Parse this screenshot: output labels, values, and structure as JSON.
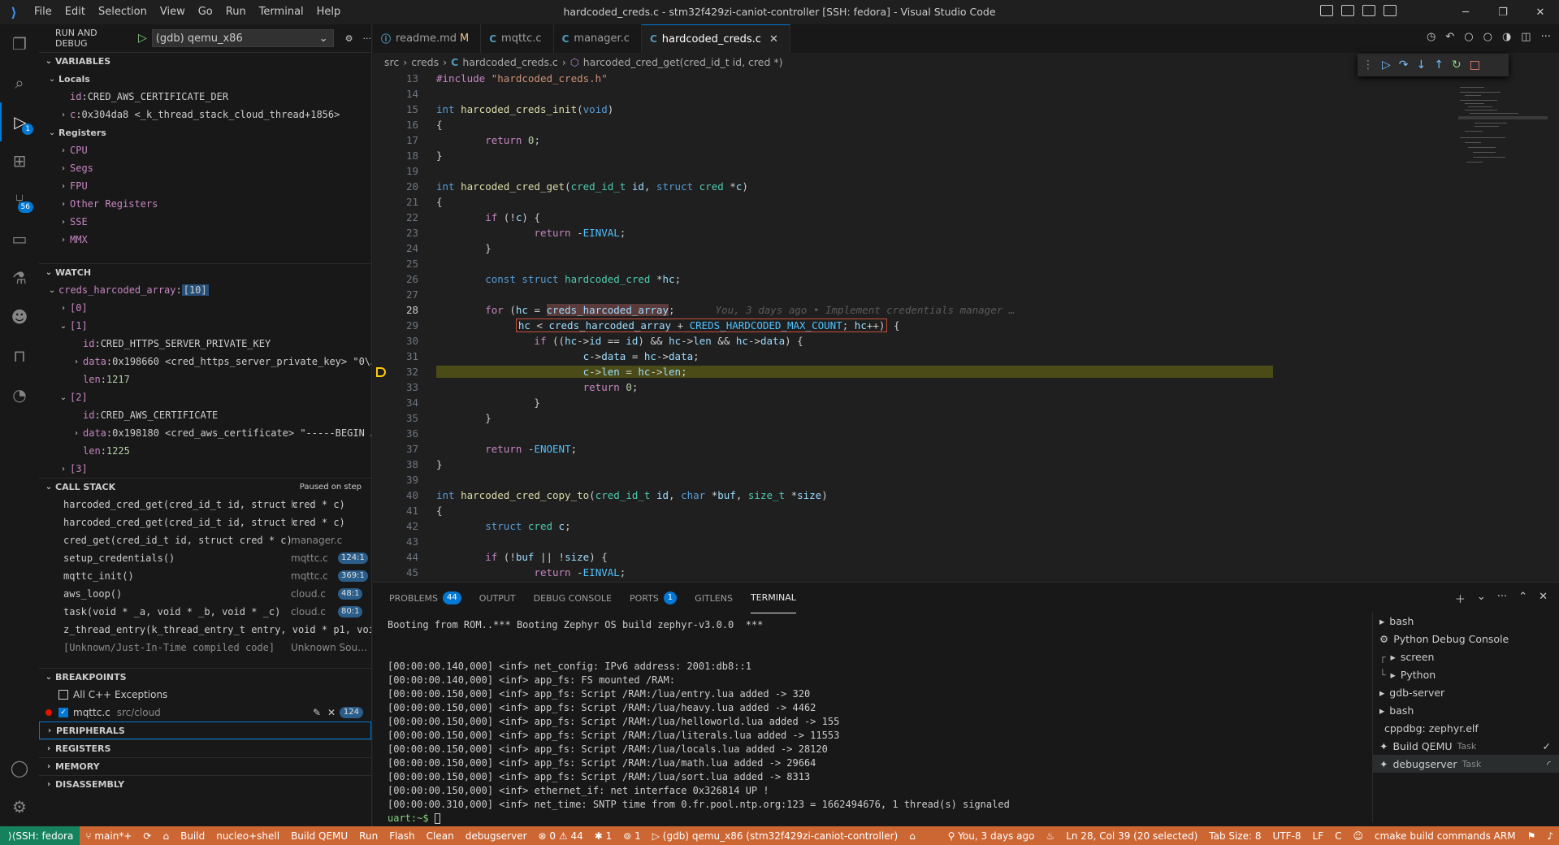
{
  "titlebar": {
    "menu": [
      "File",
      "Edit",
      "Selection",
      "View",
      "Go",
      "Run",
      "Terminal",
      "Help"
    ],
    "title": "hardcoded_creds.c - stm32f429zi-caniot-controller [SSH: fedora] - Visual Studio Code"
  },
  "activity": {
    "debug_badge": "1",
    "scm_badge": "56"
  },
  "sidebar": {
    "header": "RUN AND DEBUG",
    "config": "(gdb) qemu_x86",
    "variables_title": "VARIABLES",
    "locals_title": "Locals",
    "locals": [
      {
        "name": "id",
        "value": "CRED_AWS_CERTIFICATE_DER"
      },
      {
        "name": "c",
        "value": "0x304da8 <_k_thread_stack_cloud_thread+1856>"
      }
    ],
    "registers_title": "Registers",
    "registers": [
      "CPU",
      "Segs",
      "FPU",
      "Other Registers",
      "SSE",
      "MMX"
    ],
    "watch_title": "WATCH",
    "watch_expr": "creds_harcoded_array",
    "watch_count": "[10]",
    "watch_items": {
      "i0": "[0]",
      "i1": "[1]",
      "i1_id": "CRED_HTTPS_SERVER_PRIVATE_KEY",
      "i1_data": "0x198660 <cred_https_server_private_key> \"0\\…",
      "i1_len": "1217",
      "i2": "[2]",
      "i2_id": "CRED_AWS_CERTIFICATE",
      "i2_data": "0x198180 <cred_aws_certificate> \"-----BEGIN …",
      "i2_len": "1225",
      "i3": "[3]"
    },
    "callstack_title": "CALL STACK",
    "callstack_status": "Paused on step",
    "callstack": [
      {
        "fn": "harcoded_cred_get(cred_id_t id, struct cred * c)",
        "file": "h",
        "ln": ""
      },
      {
        "fn": "harcoded_cred_get(cred_id_t id, struct cred * c)",
        "file": "h",
        "ln": ""
      },
      {
        "fn": "cred_get(cred_id_t id, struct cred * c)",
        "file": "manager.c",
        "ln": ""
      },
      {
        "fn": "setup_credentials()",
        "file": "mqttc.c",
        "ln": "124:1"
      },
      {
        "fn": "mqttc_init()",
        "file": "mqttc.c",
        "ln": "369:1"
      },
      {
        "fn": "aws_loop()",
        "file": "cloud.c",
        "ln": "48:1"
      },
      {
        "fn": "task(void * _a, void * _b, void * _c)",
        "file": "cloud.c",
        "ln": "80:1"
      },
      {
        "fn": "z_thread_entry(k_thread_entry_t entry, void * p1, voi",
        "file": "",
        "ln": ""
      },
      {
        "fn": "[Unknown/Just-In-Time compiled code]",
        "file": "Unknown Sou…",
        "ln": ""
      }
    ],
    "breakpoints_title": "BREAKPOINTS",
    "bp_all": "All C++ Exceptions",
    "bp_file": "mqttc.c",
    "bp_path": "src/cloud",
    "bp_line": "124",
    "peripherals": "PERIPHERALS",
    "registers2": "REGISTERS",
    "memory": "MEMORY",
    "disassembly": "DISASSEMBLY"
  },
  "tabs": [
    {
      "label": "readme.md",
      "mod": "M",
      "icon": "i"
    },
    {
      "label": "mqttc.c",
      "mod": "",
      "icon": "C"
    },
    {
      "label": "manager.c",
      "mod": "",
      "icon": "C"
    },
    {
      "label": "hardcoded_creds.c",
      "mod": "",
      "icon": "C"
    }
  ],
  "breadcrumb": [
    "src",
    "creds",
    "hardcoded_creds.c",
    "harcoded_cred_get(cred_id_t id, cred *)"
  ],
  "blame": "You, 3 days ago • Implement credentials manager …",
  "panel": {
    "tabs": [
      {
        "label": "PROBLEMS",
        "badge": "44"
      },
      {
        "label": "OUTPUT",
        "badge": ""
      },
      {
        "label": "DEBUG CONSOLE",
        "badge": ""
      },
      {
        "label": "PORTS",
        "badge": "1"
      },
      {
        "label": "GITLENS",
        "badge": ""
      },
      {
        "label": "TERMINAL",
        "badge": ""
      }
    ],
    "terminal_lines": [
      "Booting from ROM..*** Booting Zephyr OS build zephyr-v3.0.0  ***",
      "",
      "",
      "[00:00:00.140,000] <inf> net_config: IPv6 address: 2001:db8::1",
      "[00:00:00.140,000] <inf> app_fs: FS mounted /RAM:",
      "[00:00:00.150,000] <inf> app_fs: Script /RAM:/lua/entry.lua added -> 320",
      "[00:00:00.150,000] <inf> app_fs: Script /RAM:/lua/heavy.lua added -> 4462",
      "[00:00:00.150,000] <inf> app_fs: Script /RAM:/lua/helloworld.lua added -> 155",
      "[00:00:00.150,000] <inf> app_fs: Script /RAM:/lua/literals.lua added -> 11553",
      "[00:00:00.150,000] <inf> app_fs: Script /RAM:/lua/locals.lua added -> 28120",
      "[00:00:00.150,000] <inf> app_fs: Script /RAM:/lua/math.lua added -> 29664",
      "[00:00:00.150,000] <inf> app_fs: Script /RAM:/lua/sort.lua added -> 8313",
      "[00:00:00.150,000] <inf> ethernet_if: net interface 0x326814 UP !",
      "[00:00:00.310,000] <inf> net_time: SNTP time from 0.fr.pool.ntp.org:123 = 1662494676, 1 thread(s) signaled"
    ],
    "prompt": "uart:~$",
    "terminals": [
      {
        "label": "bash",
        "task": ""
      },
      {
        "label": "Python Debug Console",
        "task": ""
      },
      {
        "label": "screen",
        "task": ""
      },
      {
        "label": "Python",
        "task": ""
      },
      {
        "label": "gdb-server",
        "task": ""
      },
      {
        "label": "bash",
        "task": ""
      },
      {
        "label": "cppdbg: zephyr.elf",
        "task": ""
      },
      {
        "label": "Build QEMU",
        "task": "Task"
      },
      {
        "label": "debugserver",
        "task": "Task"
      }
    ]
  },
  "status": {
    "remote": "SSH: fedora",
    "branch": "main*+",
    "items": [
      "Build",
      "nucleo+shell",
      "Build QEMU",
      "Run",
      "Flash",
      "Clean",
      "debugserver"
    ],
    "errors": "0",
    "warnings": "44",
    "x1": "1",
    "x2": "1",
    "debug": "(gdb) qemu_x86 (stm32f429zi-caniot-controller)",
    "blame": "You, 3 days ago",
    "position": "Ln 28, Col 39 (20 selected)",
    "tabsize": "Tab Size: 8",
    "encoding": "UTF-8",
    "eol": "LF",
    "lang": "C",
    "cmake": "cmake build commands ARM"
  },
  "colors": {
    "statusbar": "#cc6633",
    "remote": "#16825d",
    "accent": "#0078d4",
    "debug_line": "#4b4b18"
  }
}
